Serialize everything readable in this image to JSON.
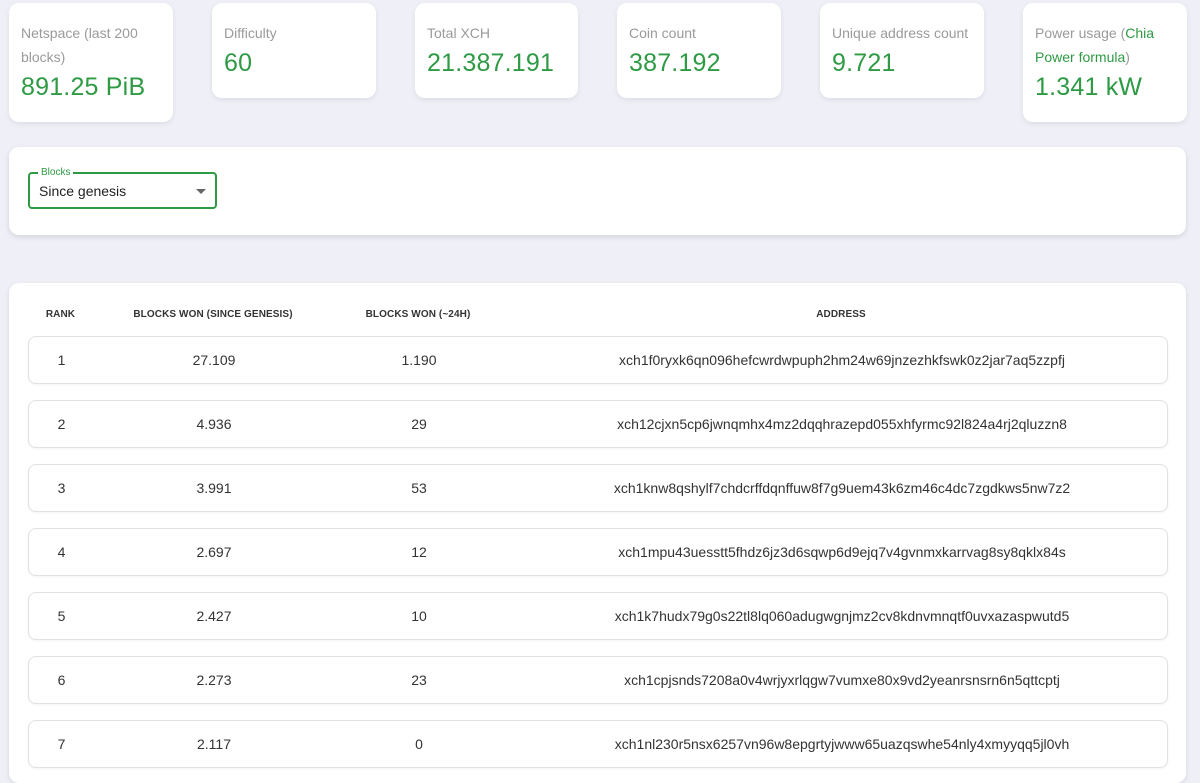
{
  "stats": [
    {
      "label": "Netspace (last 200 blocks)",
      "value": "891.25 PiB"
    },
    {
      "label": "Difficulty",
      "value": "60"
    },
    {
      "label": "Total XCH",
      "value": "21.387.191"
    },
    {
      "label": "Coin count",
      "value": "387.192"
    },
    {
      "label": "Unique address count",
      "value": "9.721"
    },
    {
      "label_prefix": "Power usage (",
      "label_link": "Chia Power formula",
      "label_suffix": ")",
      "value": "1.341 kW"
    }
  ],
  "filter": {
    "label": "Blocks",
    "selected": "Since genesis"
  },
  "table": {
    "headers": [
      "RANK",
      "BLOCKS WON (SINCE GENESIS)",
      "BLOCKS WON (~24H)",
      "ADDRESS"
    ],
    "rows": [
      {
        "rank": "1",
        "won": "27.109",
        "won24h": "1.190",
        "address": "xch1f0ryxk6qn096hefcwrdwpuph2hm24w69jnzezhkfswk0z2jar7aq5zzpfj"
      },
      {
        "rank": "2",
        "won": "4.936",
        "won24h": "29",
        "address": "xch12cjxn5cp6jwnqmhx4mz2dqqhrazepd055xhfyrmc92l824a4rj2qluzzn8"
      },
      {
        "rank": "3",
        "won": "3.991",
        "won24h": "53",
        "address": "xch1knw8qshylf7chdcrffdqnffuw8f7g9uem43k6zm46c4dc7zgdkws5nw7z2"
      },
      {
        "rank": "4",
        "won": "2.697",
        "won24h": "12",
        "address": "xch1mpu43uesstt5fhdz6jz3d6sqwp6d9ejq7v4gvnmxkarrvag8sy8qklx84s"
      },
      {
        "rank": "5",
        "won": "2.427",
        "won24h": "10",
        "address": "xch1k7hudx79g0s22tl8lq060adugwgnjmz2cv8kdnvmnqtf0uvxazaspwutd5"
      },
      {
        "rank": "6",
        "won": "2.273",
        "won24h": "23",
        "address": "xch1cpjsnds7208a0v4wrjyxrlqgw7vumxe80x9vd2yeanrsnsrn6n5qttcptj"
      },
      {
        "rank": "7",
        "won": "2.117",
        "won24h": "0",
        "address": "xch1nl230r5nsx6257vn96w8epgrtyjwww65uazqswhe54nly4xmyyqq5jl0vh"
      }
    ]
  },
  "colors": {
    "accent": "#2e9a44",
    "background": "#eff0f7"
  }
}
